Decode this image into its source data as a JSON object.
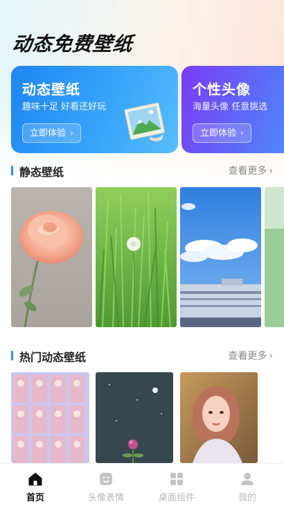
{
  "app": {
    "title": "动态免费壁纸"
  },
  "promos": [
    {
      "title": "动态壁纸",
      "subtitle": "趣味十足 好看还好玩",
      "button": "立即体验",
      "icon": "landscape-picture-icon",
      "color_from": "#1e86f2",
      "color_to": "#57bdfd"
    },
    {
      "title": "个性头像",
      "subtitle": "海量头像 任意挑选",
      "button": "立即体验",
      "color_from": "#7a3cf5",
      "color_to": "#4f8ffb"
    }
  ],
  "sections": {
    "static": {
      "title": "静态壁纸",
      "more": "查看更多",
      "items": [
        {
          "subject": "pink rose on grey"
        },
        {
          "subject": "white flower in green grass"
        },
        {
          "subject": "blue sky clouds over building"
        },
        {
          "subject": "green"
        }
      ]
    },
    "hot_dynamic": {
      "title": "热门动态壁纸",
      "more": "查看更多",
      "items": [
        {
          "subject": "tiled portrait grid"
        },
        {
          "subject": "clover flower on dark night sky"
        },
        {
          "subject": "girl portrait"
        }
      ]
    }
  },
  "tabbar": {
    "items": [
      {
        "label": "首页",
        "icon": "home-icon",
        "active": true
      },
      {
        "label": "头像表情",
        "icon": "emoji-face-icon",
        "active": false
      },
      {
        "label": "桌面组件",
        "icon": "widgets-grid-icon",
        "active": false
      },
      {
        "label": "我的",
        "icon": "profile-icon",
        "active": false
      }
    ]
  },
  "colors": {
    "accent": "#2b8ef4",
    "tab_active": "#111111",
    "tab_inactive": "#b8b8b8"
  }
}
